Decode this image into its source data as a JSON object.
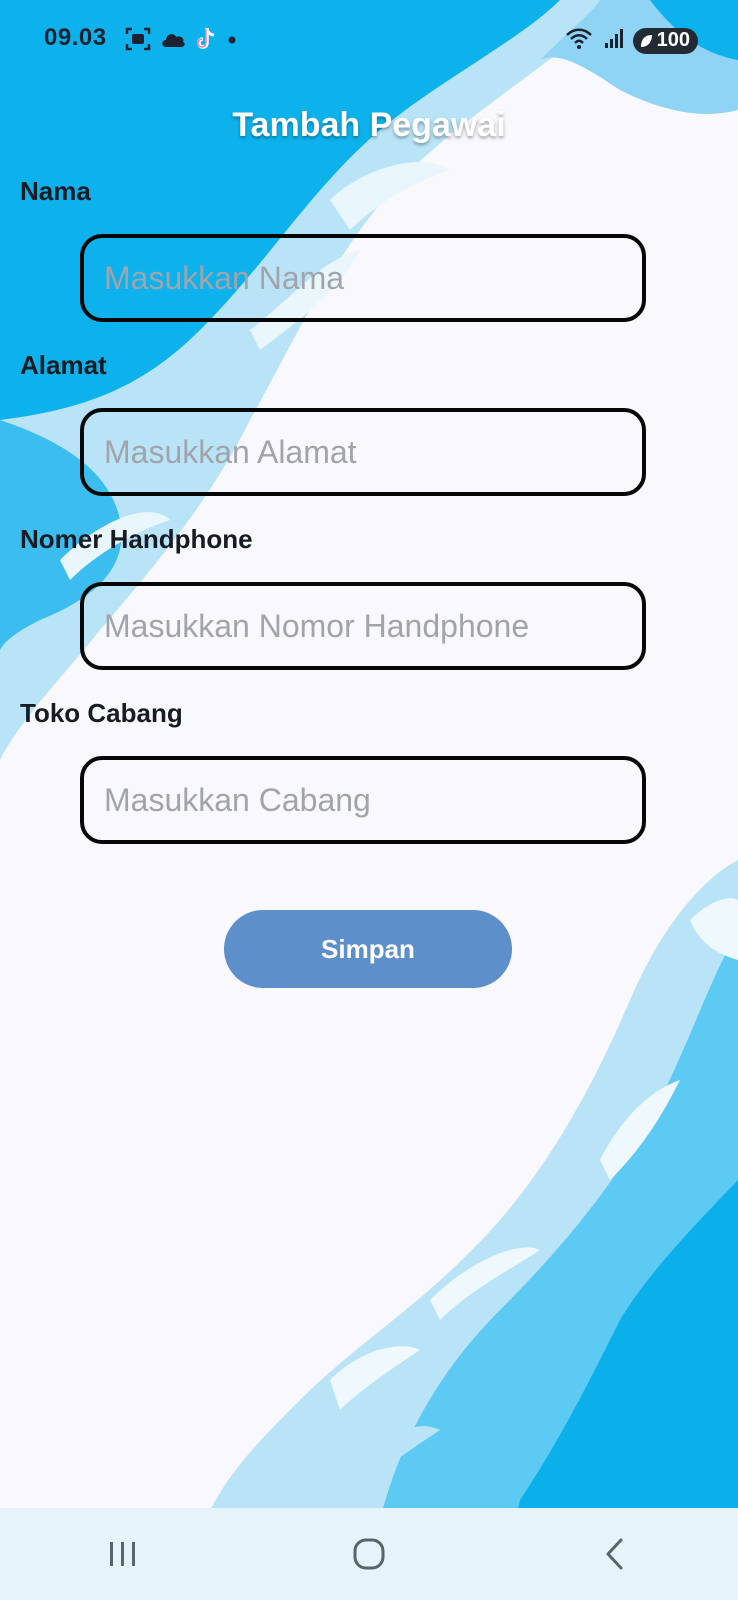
{
  "status_bar": {
    "time": "09.03",
    "battery_level": "100",
    "icons": [
      "screenshot-icon",
      "cloud-icon",
      "tiktok-icon",
      "notification-dot-icon",
      "wifi-icon",
      "signal-icon",
      "battery-icon"
    ]
  },
  "page": {
    "title": "Tambah Pegawai"
  },
  "form": {
    "fields": [
      {
        "label": "Nama",
        "placeholder": "Masukkan Nama",
        "value": ""
      },
      {
        "label": "Alamat",
        "placeholder": "Masukkan Alamat",
        "value": ""
      },
      {
        "label": "Nomer Handphone",
        "placeholder": "Masukkan Nomor Handphone",
        "value": ""
      },
      {
        "label": "Toko Cabang",
        "placeholder": "Masukkan Cabang",
        "value": ""
      }
    ],
    "submit_label": "Simpan"
  },
  "navigation": {
    "icons": [
      "recent-apps-icon",
      "home-icon",
      "back-icon"
    ]
  },
  "colors": {
    "background": "#f9f8fd",
    "wave_primary": "#4ec4f2",
    "wave_light": "#b6e3f8",
    "button": "#5d8fcb",
    "input_border": "#070707",
    "nav_bar": "#e5f4fb"
  }
}
